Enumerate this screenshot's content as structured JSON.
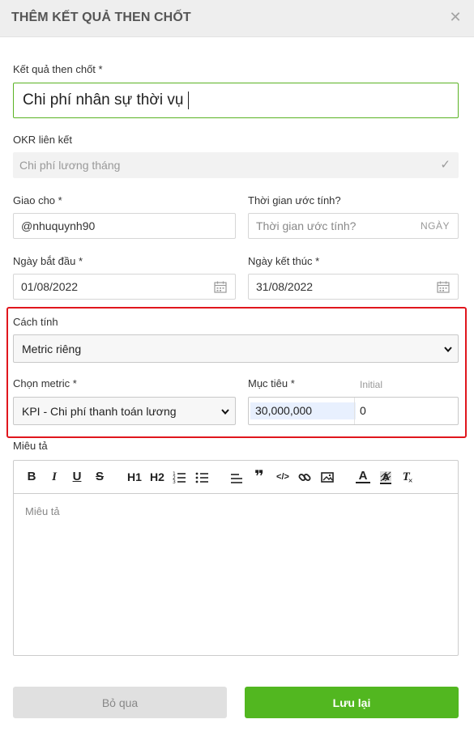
{
  "dialog": {
    "title": "THÊM KẾT QUẢ THEN CHỐT",
    "close_icon": "close-icon"
  },
  "form": {
    "key_result": {
      "label": "Kết quả then chốt *",
      "value": "Chi phí nhân sự thời vụ"
    },
    "linked_okr": {
      "label": "OKR liên kết",
      "value": "Chi phí lương tháng",
      "icon": "check-icon"
    },
    "assign_to": {
      "label": "Giao cho *",
      "value": "@nhuquynh90"
    },
    "estimated_time": {
      "label": "Thời gian ước tính?",
      "placeholder": "Thời gian ước tính?",
      "unit": "NGÀY"
    },
    "start_date": {
      "label": "Ngày bắt đầu *",
      "value": "01/08/2022",
      "icon": "calendar-icon"
    },
    "end_date": {
      "label": "Ngày kết thúc *",
      "value": "31/08/2022",
      "icon": "calendar-icon"
    },
    "calc_method": {
      "label": "Cách tính",
      "value": "Metric riêng"
    },
    "metric": {
      "label": "Chọn metric *",
      "value": "KPI - Chi phí thanh toán lương"
    },
    "target": {
      "label": "Mục tiêu *",
      "value": "30,000,000",
      "initial_label": "Initial",
      "initial_value": "0"
    },
    "description": {
      "label": "Miêu tả",
      "placeholder": "Miêu tả"
    }
  },
  "toolbar": {
    "buttons": [
      "bold",
      "italic",
      "underline",
      "strikethrough",
      "heading-1",
      "heading-2",
      "ordered-list",
      "bullet-list",
      "align",
      "blockquote",
      "code",
      "link",
      "image",
      "text-color",
      "highlight",
      "clear-format"
    ],
    "labels": {
      "bold": "B",
      "italic": "I",
      "underline": "U",
      "strike": "S",
      "h1": "H1",
      "h2": "H2",
      "quote": "❞",
      "code": "</>",
      "text_color": "A",
      "clear": "T"
    }
  },
  "actions": {
    "cancel": "Bỏ qua",
    "save": "Lưu lại"
  },
  "colors": {
    "accent_green": "#52b720",
    "field_border_focus": "#5ab323",
    "highlight_red": "#e0161d"
  }
}
